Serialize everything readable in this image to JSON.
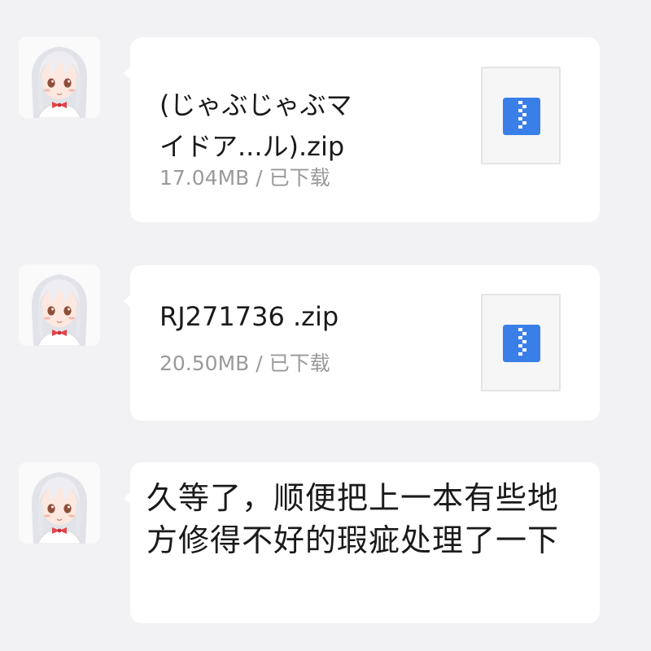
{
  "messages": [
    {
      "type": "file",
      "avatar_icon": "anime-girl-avatar",
      "file_name_line1": "(じゃぶじゃぶマ",
      "file_name_line2": "イドア...ル).zip",
      "meta": "17.04MB / 已下载",
      "file_icon": "zip-archive-icon"
    },
    {
      "type": "file",
      "avatar_icon": "anime-girl-avatar",
      "file_name_line1": "RJ271736 .zip",
      "meta": "20.50MB / 已下载",
      "file_icon": "zip-archive-icon"
    },
    {
      "type": "text",
      "avatar_icon": "anime-girl-avatar",
      "text": "久等了，顺便把上一本有些地方修得不好的瑕疵处理了一下"
    }
  ],
  "colors": {
    "background": "#f2f2f4",
    "bubble": "#ffffff",
    "zip_icon_blue": "#3a7fe8",
    "meta_gray": "#9a9a9a"
  }
}
